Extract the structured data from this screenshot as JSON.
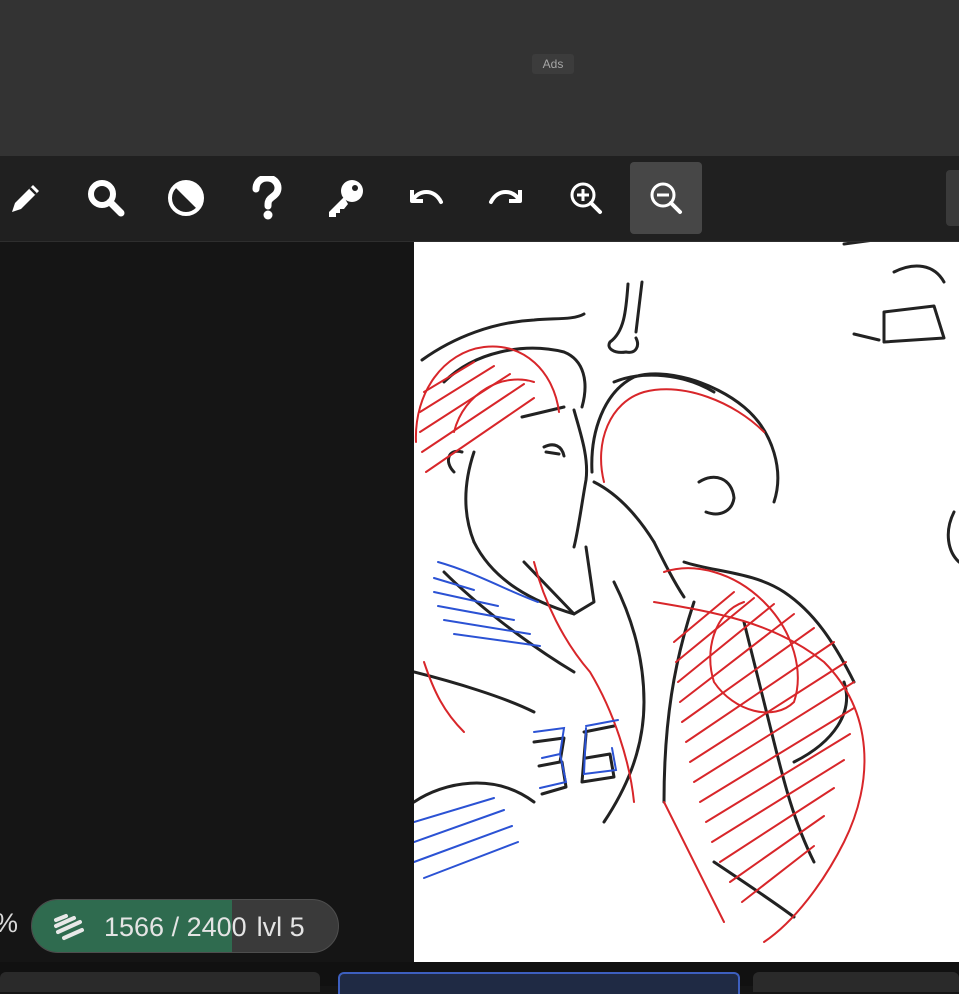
{
  "ads": {
    "label": "Ads"
  },
  "toolbar": {
    "tools": [
      {
        "id": "pencil",
        "icon": "pencil-icon"
      },
      {
        "id": "search",
        "icon": "search-icon"
      },
      {
        "id": "contrast",
        "icon": "contrast-icon"
      },
      {
        "id": "help",
        "icon": "question-icon"
      },
      {
        "id": "key",
        "icon": "key-icon"
      },
      {
        "id": "undo",
        "icon": "undo-icon"
      },
      {
        "id": "redo",
        "icon": "redo-icon"
      },
      {
        "id": "zoom-in",
        "icon": "zoom-in-icon"
      },
      {
        "id": "zoom-out",
        "icon": "zoom-out-icon",
        "active": true
      }
    ]
  },
  "status": {
    "zoom_fragment": "%",
    "xp": {
      "current": "1566",
      "separator": " / ",
      "max": "2400",
      "level": "lvl 5",
      "progress": 0.6525
    }
  },
  "colors": {
    "accent_green": "#2f6b4f",
    "active_tab": "#1f2a44",
    "sketch_red": "#d8262a",
    "sketch_blue": "#2b52d4"
  }
}
